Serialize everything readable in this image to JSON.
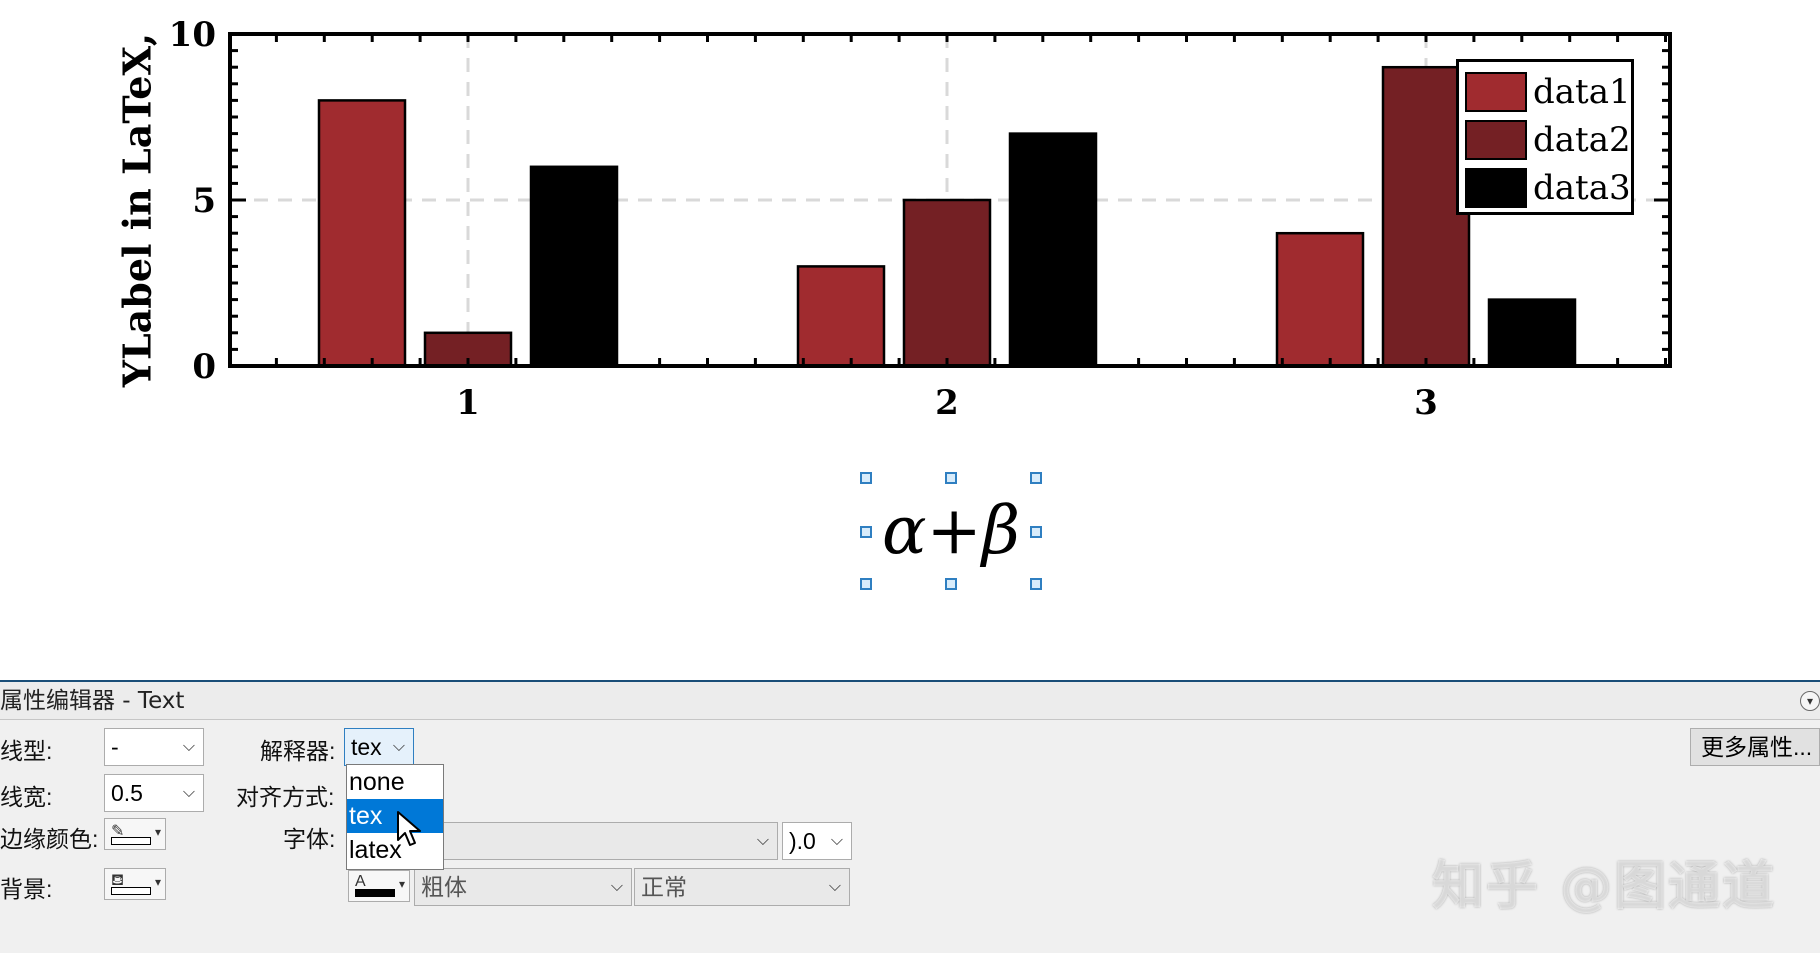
{
  "chart_data": {
    "type": "bar",
    "categories": [
      "1",
      "2",
      "3"
    ],
    "series": [
      {
        "name": "data1",
        "values": [
          8,
          3,
          4
        ],
        "color": "#a02b2f"
      },
      {
        "name": "data2",
        "values": [
          1,
          5,
          9
        ],
        "color": "#742024"
      },
      {
        "name": "data3",
        "values": [
          6,
          7,
          2
        ],
        "color": "#000000"
      }
    ],
    "ylabel": "YLabel in LaTeX,",
    "ylim": [
      0,
      10
    ],
    "yticks": [
      "0",
      "5",
      "10"
    ],
    "grid": true,
    "legend_position": "top-right"
  },
  "figure": {
    "text_object": "α+β"
  },
  "property_editor": {
    "title": "属性编辑器 - Text",
    "line_style_label": "线型:",
    "line_style_value": "-",
    "line_width_label": "线宽:",
    "line_width_value": "0.5",
    "edge_color_label": "边缘颜色:",
    "background_label": "背景:",
    "interpreter_label": "解释器:",
    "interpreter_value": "tex",
    "interpreter_options": [
      "none",
      "tex",
      "latex"
    ],
    "interpreter_selected": "tex",
    "alignment_label": "对齐方式:",
    "font_label": "字体:",
    "font_size_value": ").0",
    "font_weight_value": "粗体",
    "font_angle_value": "正常",
    "more_properties_button": "更多属性..."
  },
  "watermark": "知乎 @图通道"
}
